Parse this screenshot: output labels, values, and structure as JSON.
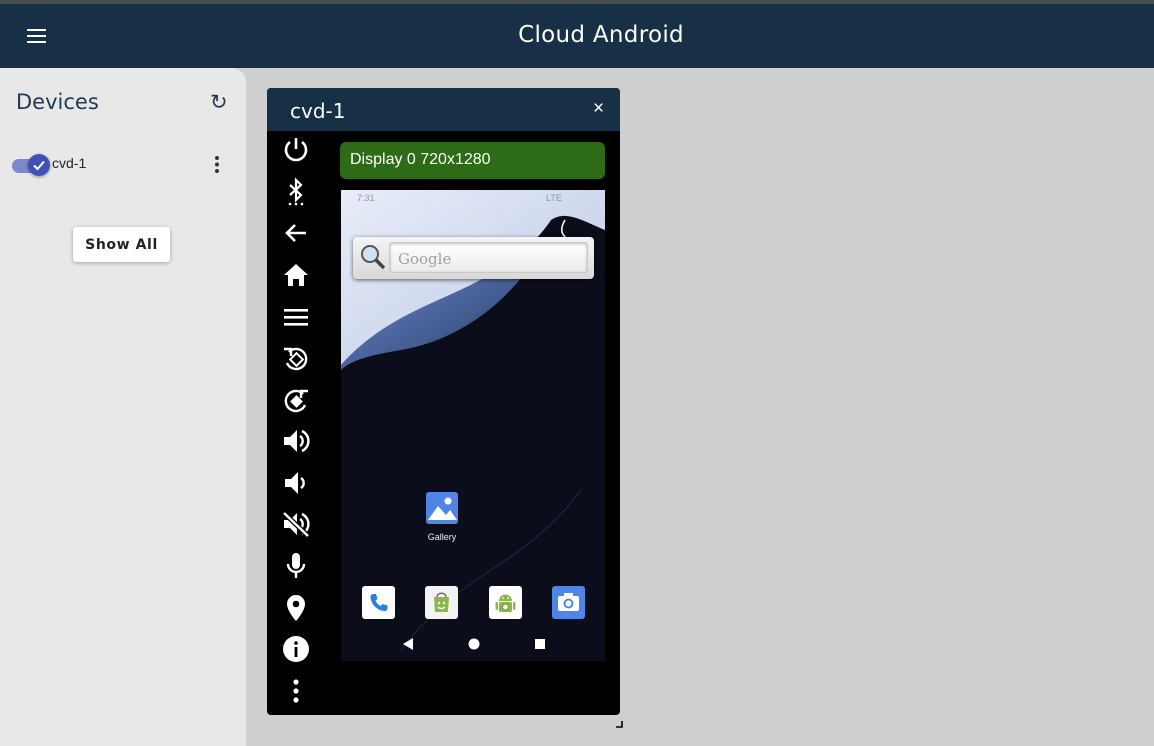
{
  "appbar": {
    "title": "Cloud Android",
    "menu_icon": "menu-icon"
  },
  "sidebar": {
    "title": "Devices",
    "refresh_label": "↻",
    "devices": [
      {
        "name": "cvd-1",
        "enabled": true
      }
    ],
    "show_all_label": "Show All"
  },
  "device_window": {
    "title": "cvd-1",
    "close_label": "×",
    "display_label": "Display 0 720x1280",
    "controls": [
      "power-icon",
      "bluetooth-icon",
      "back-icon",
      "home-icon",
      "menu-icon",
      "rotate-left-icon",
      "rotate-right-icon",
      "volume-up-icon",
      "volume-down-icon",
      "volume-mute-icon",
      "microphone-icon",
      "location-icon",
      "info-icon",
      "more-vert-icon"
    ]
  },
  "screen": {
    "status_time": "7:31",
    "status_network": "LTE",
    "search_placeholder": "Google",
    "gallery_label": "Gallery",
    "dock": [
      "phone-icon",
      "store-icon",
      "android-icon",
      "camera-icon"
    ],
    "nav": [
      "nav-back-icon",
      "nav-home-icon",
      "nav-recents-icon"
    ]
  },
  "colors": {
    "appbar": "#173046",
    "sidebar": "#e8e8e8",
    "display_label": "#2e6b16",
    "toggle": "#3f51b5",
    "background": "#cfcfcf"
  }
}
